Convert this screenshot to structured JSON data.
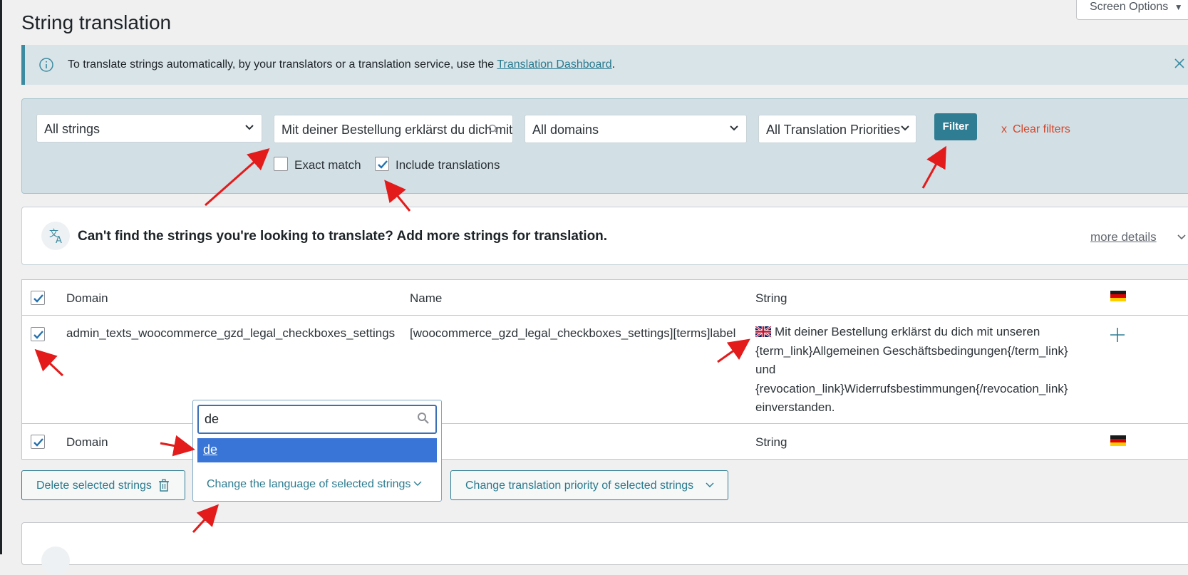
{
  "header": {
    "screen_options": "Screen Options",
    "title": "String translation"
  },
  "notice": {
    "text_before": "To translate strings automatically, by your translators or a translation service, use the",
    "link": "Translation Dashboard",
    "text_after": "."
  },
  "filters": {
    "type_select": "All strings",
    "search_value": "Mit deiner Bestellung erklärst du dich mit",
    "domain_select": "All domains",
    "priority_select": "All Translation Priorities",
    "exact_match_label": "Exact match",
    "exact_match_checked": false,
    "include_translations_label": "Include translations",
    "include_translations_checked": true,
    "filter_button": "Filter",
    "clear_filters": "Clear filters",
    "clear_x": "x"
  },
  "more_strings": {
    "title": "Can't find the strings you're looking to translate? Add more strings for translation.",
    "more_details": "more details"
  },
  "table": {
    "columns": {
      "domain": "Domain",
      "name": "Name",
      "string": "String"
    },
    "rows": [
      {
        "domain": "admin_texts_woocommerce_gzd_legal_checkboxes_settings",
        "name": "[woocommerce_gzd_legal_checkboxes_settings][terms]label",
        "string_lines": [
          "Mit deiner Bestellung erklärst du dich mit unseren",
          "{term_link}Allgemeinen Geschäftsbedingungen{/term_link}",
          "und",
          "{revocation_link}Widerrufsbestimmungen{/revocation_link}",
          "einverstanden."
        ]
      }
    ],
    "footer": {
      "domain": "Domain",
      "string": "String"
    }
  },
  "bulk_actions": {
    "delete": "Delete selected strings",
    "change_language": "Change the language of selected strings",
    "change_priority": "Change translation priority of selected strings"
  },
  "language_dropdown": {
    "search_value": "de",
    "option": "de"
  },
  "colors": {
    "accent": "#2e7d93",
    "notice_bg": "#d9e4e9",
    "filter_panel_bg": "#d2dfe5",
    "clear_filters": "#d1472d",
    "dropdown_highlight": "#3875d7",
    "annotation_arrow": "#e31b1b"
  }
}
